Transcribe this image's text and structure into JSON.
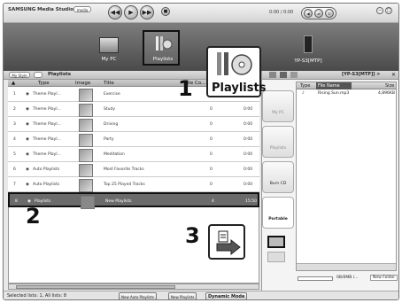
{
  "app": {
    "logo": "SAMSUNG Media Studio",
    "badge": "media",
    "time": "0:00 / 0:00"
  },
  "nav": {
    "my_pc": "My PC",
    "playlists": "Playlists",
    "device": "YP-S3[MTP]"
  },
  "toolbar": {
    "my_style": "My Style",
    "section": "Playlists"
  },
  "table": {
    "headers": [
      "Type",
      "Image",
      "Title",
      "File Co..."
    ],
    "rows": [
      {
        "num": "1",
        "type": "Theme Playl...",
        "title": "Exercise",
        "count": "0",
        "dur": "0:00"
      },
      {
        "num": "2",
        "type": "Theme Playl...",
        "title": "Study",
        "count": "0",
        "dur": "0:00"
      },
      {
        "num": "3",
        "type": "Theme Playl...",
        "title": "Driving",
        "count": "0",
        "dur": "0:00"
      },
      {
        "num": "4",
        "type": "Theme Playl...",
        "title": "Party",
        "count": "0",
        "dur": "0:00"
      },
      {
        "num": "5",
        "type": "Theme Playl...",
        "title": "Meditation",
        "count": "0",
        "dur": "0:00"
      },
      {
        "num": "6",
        "type": "Auto Playlists",
        "title": "Most Favorite Tracks",
        "count": "0",
        "dur": "0:00"
      },
      {
        "num": "7",
        "type": "Auto Playlists",
        "title": "Top 25 Played Tracks",
        "count": "0",
        "dur": "0:00"
      },
      {
        "num": "8",
        "type": "Playlists",
        "title": "New Playlists",
        "count": "4",
        "dur": "15:50"
      }
    ]
  },
  "status": {
    "selected": "Selected lists: 1, All lists: 8",
    "new_auto": "New Auto Playlists",
    "new_playlists": "New Playlists",
    "dynamic": "Dynamic Mode"
  },
  "device_panel": {
    "path": "[YP-S3[MTP]] >",
    "col_type": "Type",
    "col_name": "File Name",
    "col_size": "Size",
    "file_name": "Rising Sun.mp3",
    "file_size": "4,896KB",
    "tab_mypc": "My PC",
    "tab_playlists": "Playlists",
    "tab_burn": "Burn CD",
    "tab_portable": "Portable",
    "capacity": "0B/0MB /...",
    "new_folder": "New Folder"
  },
  "callouts": {
    "playlists_label": "Playlists",
    "n1": "1",
    "n2": "2",
    "n3": "3"
  }
}
